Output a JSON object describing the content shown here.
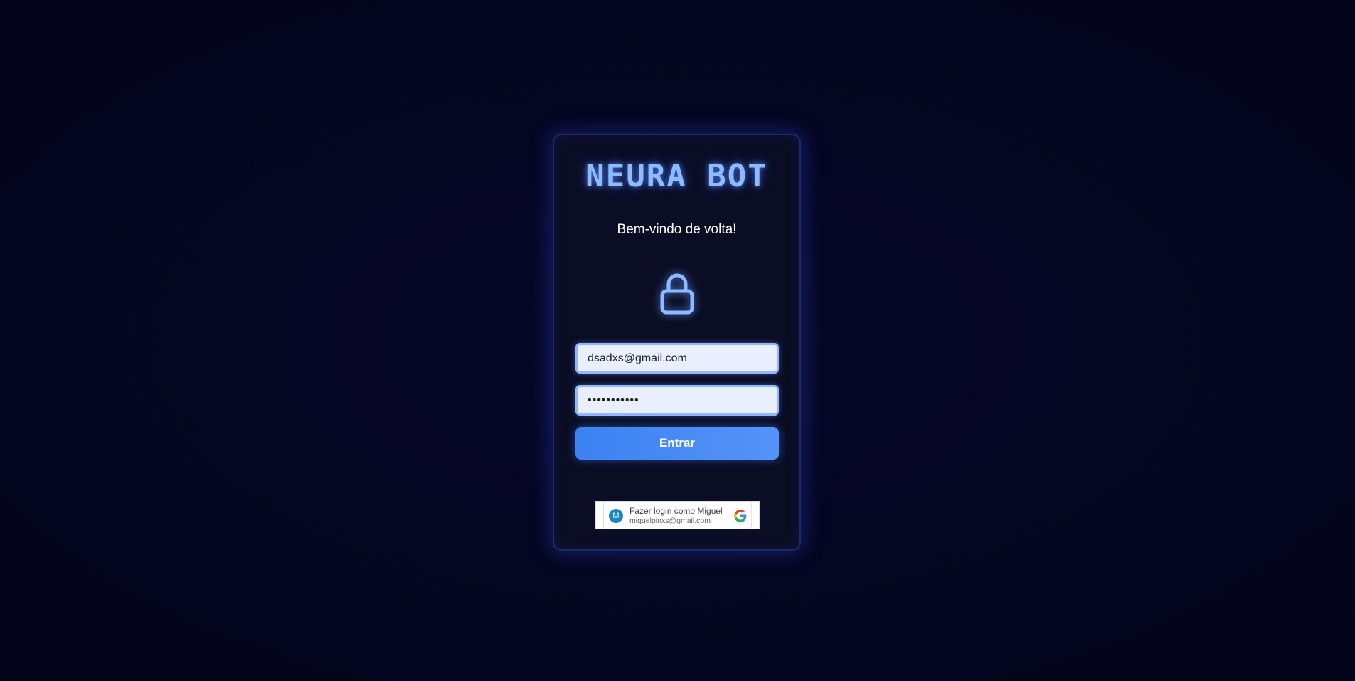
{
  "brand": {
    "title": "NEURA BOT"
  },
  "login": {
    "subtitle": "Bem-vindo de volta!",
    "lock_icon": "lock-icon",
    "email_value": "dsadxs@gmail.com",
    "password_value": "•••••••••••",
    "submit_label": "Entrar"
  },
  "google_signin": {
    "line1": "Fazer login como Miguel",
    "line2": "miguelpinxs@gmail.com",
    "avatar_initial": "M",
    "logo_icon": "google-g-icon"
  },
  "colors": {
    "accent": "#8ebbff",
    "button": "#3c82f2",
    "background": "#050622",
    "card": "#0b0d24"
  }
}
